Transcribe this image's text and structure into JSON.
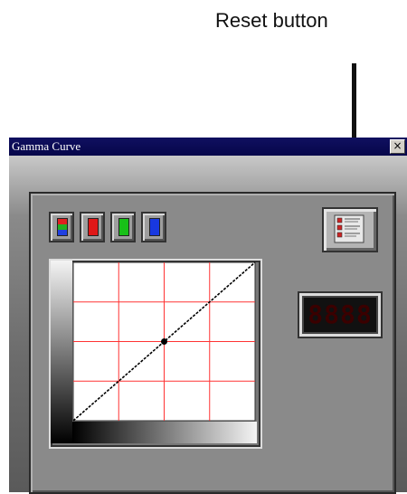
{
  "annotation": {
    "text": "Reset button"
  },
  "window": {
    "title": "Gamma Curve",
    "close_label": "×"
  },
  "channels": [
    {
      "id": "rgb",
      "name": "all-channels",
      "color": "rgb"
    },
    {
      "id": "red",
      "name": "red-channel",
      "color": "#e01818"
    },
    {
      "id": "green",
      "name": "green-channel",
      "color": "#18c018"
    },
    {
      "id": "blue",
      "name": "blue-channel",
      "color": "#1838e0"
    }
  ],
  "led_display": {
    "value": "8888",
    "color": "#3a0000"
  },
  "graph": {
    "grid_color": "#ff3333",
    "curve_color": "#000000",
    "grid_divisions": 4,
    "curve": "linear",
    "control_point": {
      "input": 0.5,
      "output": 0.5
    }
  }
}
